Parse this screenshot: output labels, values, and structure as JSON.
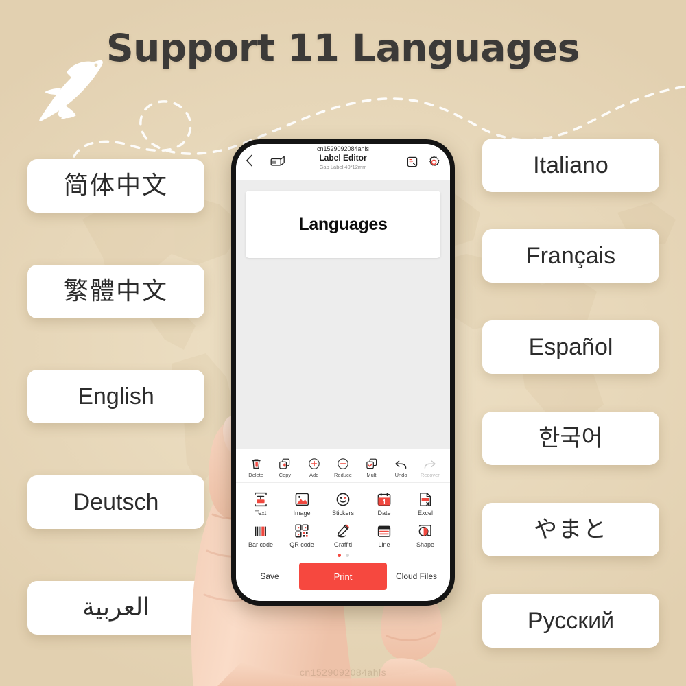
{
  "headline": "Support 11 Languages",
  "decor": {
    "plane_icon": "airplane-icon",
    "route_icon": "dashed-flight-path",
    "map_icon": "world-map-watermark"
  },
  "watermark": {
    "bottom": "cn1529092084ahls"
  },
  "languages": {
    "left": [
      {
        "label": "简体中文",
        "style": "cjk",
        "name": "language-card-simplified-chinese"
      },
      {
        "label": "繁體中文",
        "style": "cjk",
        "name": "language-card-traditional-chinese"
      },
      {
        "label": "English",
        "style": "lat",
        "name": "language-card-english"
      },
      {
        "label": "Deutsch",
        "style": "lat",
        "name": "language-card-german"
      },
      {
        "label": "العربية",
        "style": "ara",
        "name": "language-card-arabic"
      }
    ],
    "right": [
      {
        "label": "Italiano",
        "style": "lat",
        "name": "language-card-italian"
      },
      {
        "label": "Français",
        "style": "lat",
        "name": "language-card-french"
      },
      {
        "label": "Español",
        "style": "lat",
        "name": "language-card-spanish"
      },
      {
        "label": "한국어",
        "style": "kor",
        "name": "language-card-korean"
      },
      {
        "label": "やまと",
        "style": "jpn",
        "name": "language-card-japanese"
      },
      {
        "label": "Русский",
        "style": "cyr",
        "name": "language-card-russian"
      }
    ]
  },
  "phone": {
    "topbar": {
      "back_icon": "chevron-left-icon",
      "printer_icon": "printer-device-icon",
      "sku": "cn1529092084ahls",
      "title": "Label Editor",
      "subtitle": "Gap Label:40*12mm",
      "scan_icon": "scan-label-icon",
      "settings_icon": "gear-icon"
    },
    "canvas": {
      "label_text": "Languages"
    },
    "toolbar_row1": [
      {
        "label": "Delete",
        "icon": "trash-icon",
        "disabled": false
      },
      {
        "label": "Copy",
        "icon": "copy-icon",
        "disabled": false
      },
      {
        "label": "Add",
        "icon": "plus-circle-icon",
        "disabled": false
      },
      {
        "label": "Reduce",
        "icon": "minus-circle-icon",
        "disabled": false
      },
      {
        "label": "Multi",
        "icon": "multi-select-icon",
        "disabled": false
      },
      {
        "label": "Undo",
        "icon": "undo-arrow-icon",
        "disabled": false
      },
      {
        "label": "Recover",
        "icon": "redo-arrow-icon",
        "disabled": true
      }
    ],
    "toolbar_row2": [
      {
        "label": "Text",
        "icon": "text-tool-icon"
      },
      {
        "label": "Image",
        "icon": "image-icon"
      },
      {
        "label": "Stickers",
        "icon": "smiley-sticker-icon"
      },
      {
        "label": "Date",
        "icon": "calendar-icon"
      },
      {
        "label": "Excel",
        "icon": "excel-file-icon"
      }
    ],
    "toolbar_row3": [
      {
        "label": "Bar code",
        "icon": "barcode-icon"
      },
      {
        "label": "QR code",
        "icon": "qr-code-icon"
      },
      {
        "label": "Graffiti",
        "icon": "pencil-graffiti-icon"
      },
      {
        "label": "Line",
        "icon": "line-table-icon"
      },
      {
        "label": "Shape",
        "icon": "shape-icon"
      }
    ],
    "pager": {
      "total": 2,
      "active": 0
    },
    "bottom": {
      "save_label": "Save",
      "print_label": "Print",
      "cloud_label": "Cloud Files"
    }
  },
  "colors": {
    "accent_red": "#f6483f",
    "background_beige": "#e9dabd",
    "title_gray": "#3c3a38",
    "phone_frame": "#141414"
  }
}
